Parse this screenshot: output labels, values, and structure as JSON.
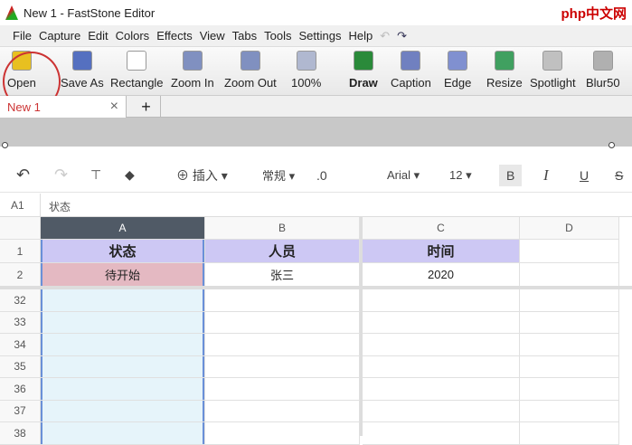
{
  "window": {
    "title": "New 1 - FastStone Editor",
    "watermark": "php中文网"
  },
  "menu": [
    "File",
    "Capture",
    "Edit",
    "Colors",
    "Effects",
    "View",
    "Tabs",
    "Tools",
    "Settings",
    "Help"
  ],
  "toolbar": [
    {
      "label": "Open",
      "icon": "open-folder-icon",
      "color": "#e8c020"
    },
    {
      "label": "Save As",
      "icon": "save-icon",
      "color": "#5570c0"
    },
    {
      "label": "Rectangle",
      "icon": "rectangle-select-icon",
      "color": "#ffffff"
    },
    {
      "label": "Zoom In",
      "icon": "zoom-in-icon",
      "color": "#8090c0"
    },
    {
      "label": "Zoom Out",
      "icon": "zoom-out-icon",
      "color": "#8090c0"
    },
    {
      "label": "100%",
      "icon": "zoom-100-icon",
      "color": "#b0b8d0"
    },
    {
      "label": "Draw",
      "icon": "draw-icon",
      "color": "#2a8a3a"
    },
    {
      "label": "Caption",
      "icon": "caption-icon",
      "color": "#7080c0"
    },
    {
      "label": "Edge",
      "icon": "edge-icon",
      "color": "#8090d0"
    },
    {
      "label": "Resize",
      "icon": "resize-icon",
      "color": "#40a060"
    },
    {
      "label": "Spotlight",
      "icon": "spotlight-icon",
      "color": "#c0c0c0"
    },
    {
      "label": "Blur50",
      "icon": "blur-icon",
      "color": "#b0b0b0"
    }
  ],
  "tab": {
    "label": "New 1",
    "close": "×",
    "add": "+"
  },
  "sheet_toolbar": {
    "insert": "插入",
    "format": "常规",
    "decimal": ".0",
    "font": "Arial",
    "size": "12",
    "bold": "B",
    "italic": "I",
    "underline": "U",
    "strike": "S"
  },
  "formula": {
    "ref": "A1",
    "value": "状态"
  },
  "columns": [
    "A",
    "B",
    "C",
    "D"
  ],
  "rows": [
    {
      "num": "1",
      "cells": [
        "状态",
        "人员",
        "时间",
        ""
      ]
    },
    {
      "num": "2",
      "cells": [
        "待开始",
        "张三",
        "2020",
        ""
      ]
    }
  ],
  "more_rows": [
    "32",
    "33",
    "34",
    "35",
    "36",
    "37",
    "38"
  ]
}
